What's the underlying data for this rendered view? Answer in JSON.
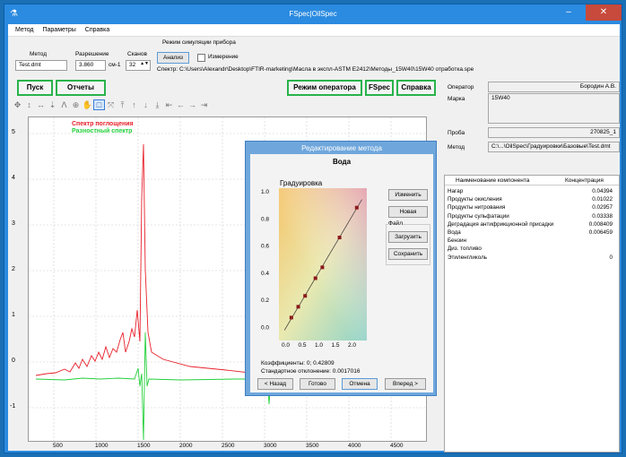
{
  "window": {
    "title": "FSpec|OilSpec",
    "minimize": "–",
    "maximize": "□",
    "close": "✕"
  },
  "menu": [
    "Метод",
    "Параметры",
    "Справка"
  ],
  "top": {
    "mode_label": "Режим симуляции прибора",
    "method_label": "Метод",
    "method_value": "Test.dmt",
    "resolution_label": "Разрешение",
    "resolution_value": "3.860",
    "resolution_unit": "см-1",
    "scans_label": "Сканов",
    "scans_value": "32",
    "analysis_button": "Анализ",
    "measure_label": "Измерение",
    "spectrum_path": "Спектр: C:\\Users\\Alexandr\\Desktop\\FTIR-marketing\\Масла в экспл-ASTM E2412\\Методы_15W40\\15W40 отработка.spe"
  },
  "buttons": {
    "start": "Пуск",
    "reports": "Отчеты",
    "operator_mode": "Режим оператора",
    "fspec": "FSpec",
    "help": "Справка"
  },
  "toolbar_icons": [
    "move-icon",
    "vertical-move-icon",
    "horizontal-move-icon",
    "down-icon",
    "peak-icon",
    "zoom-plus-icon",
    "hand-icon",
    "select-rect-icon",
    "fit-icon",
    "top-icon",
    "up-icon",
    "down-arrow-icon",
    "bottom-icon",
    "left-end-icon",
    "left-icon",
    "right-icon",
    "right-end-icon"
  ],
  "plot": {
    "legend_absorption": "Спектр поглощения",
    "legend_difference": "Разностный спектр",
    "yticks": [
      "5",
      "4",
      "3",
      "2",
      "1",
      "0",
      "-1"
    ],
    "xticks": [
      "500",
      "1000",
      "1500",
      "2000",
      "2500",
      "3000",
      "3500",
      "4000",
      "4500"
    ],
    "colors": {
      "absorption": "#e8202a",
      "difference": "#22d03a"
    }
  },
  "dialog": {
    "title": "Редактирование метода",
    "component": "Вода",
    "calib_label": "Градуировка",
    "ymin_labels": [
      "1.0",
      "0.8",
      "0.6",
      "0.4",
      "0.2",
      "0.0"
    ],
    "x_labels": [
      "0.0",
      "0.5",
      "1.0",
      "1.5",
      "2.0"
    ],
    "btn_change": "Изменить",
    "btn_new": "Новая",
    "file_group": "Файл",
    "btn_load": "Загрузить",
    "btn_save": "Сохранить",
    "coeffs": "Коэффициенты: 0;  0.42809",
    "stddev": "Стандартное отклонение: 0.0017016",
    "btn_back": "< Назад",
    "btn_done": "Готово",
    "btn_cancel": "Отмена",
    "btn_next": "Вперед >",
    "calib_points": [
      [
        0.1,
        0.05
      ],
      [
        0.3,
        0.13
      ],
      [
        0.5,
        0.21
      ],
      [
        0.8,
        0.34
      ],
      [
        1.0,
        0.42
      ],
      [
        1.5,
        0.64
      ],
      [
        2.0,
        0.86
      ]
    ]
  },
  "right": {
    "operator_label": "Оператор",
    "operator_value": "Бородин А.В.",
    "brand_label": "Марка",
    "brand_value": "15W40",
    "sample_label": "Проба",
    "sample_value": "270825_1",
    "method_label": "Метод",
    "method_value": "C:\\...\\OilSpec\\Градуировки\\Базовые\\Test.dmt",
    "col_name": "Наименование компонента",
    "col_conc": "Концентрация",
    "rows": [
      {
        "name": "Нагар",
        "value": "0.04394"
      },
      {
        "name": "Продукты окисления",
        "value": "0.01022"
      },
      {
        "name": "Продукты нитрования",
        "value": "0.02957"
      },
      {
        "name": "Продукты сульфатации",
        "value": "0.03338"
      },
      {
        "name": "Деградация антифрикционной присадки",
        "value": "0.008409"
      },
      {
        "name": "Вода",
        "value": "0.006459"
      },
      {
        "name": "Бензин",
        "value": ""
      },
      {
        "name": "Диз. топливо",
        "value": ""
      },
      {
        "name": "Этиленгликоль",
        "value": "0"
      }
    ]
  }
}
